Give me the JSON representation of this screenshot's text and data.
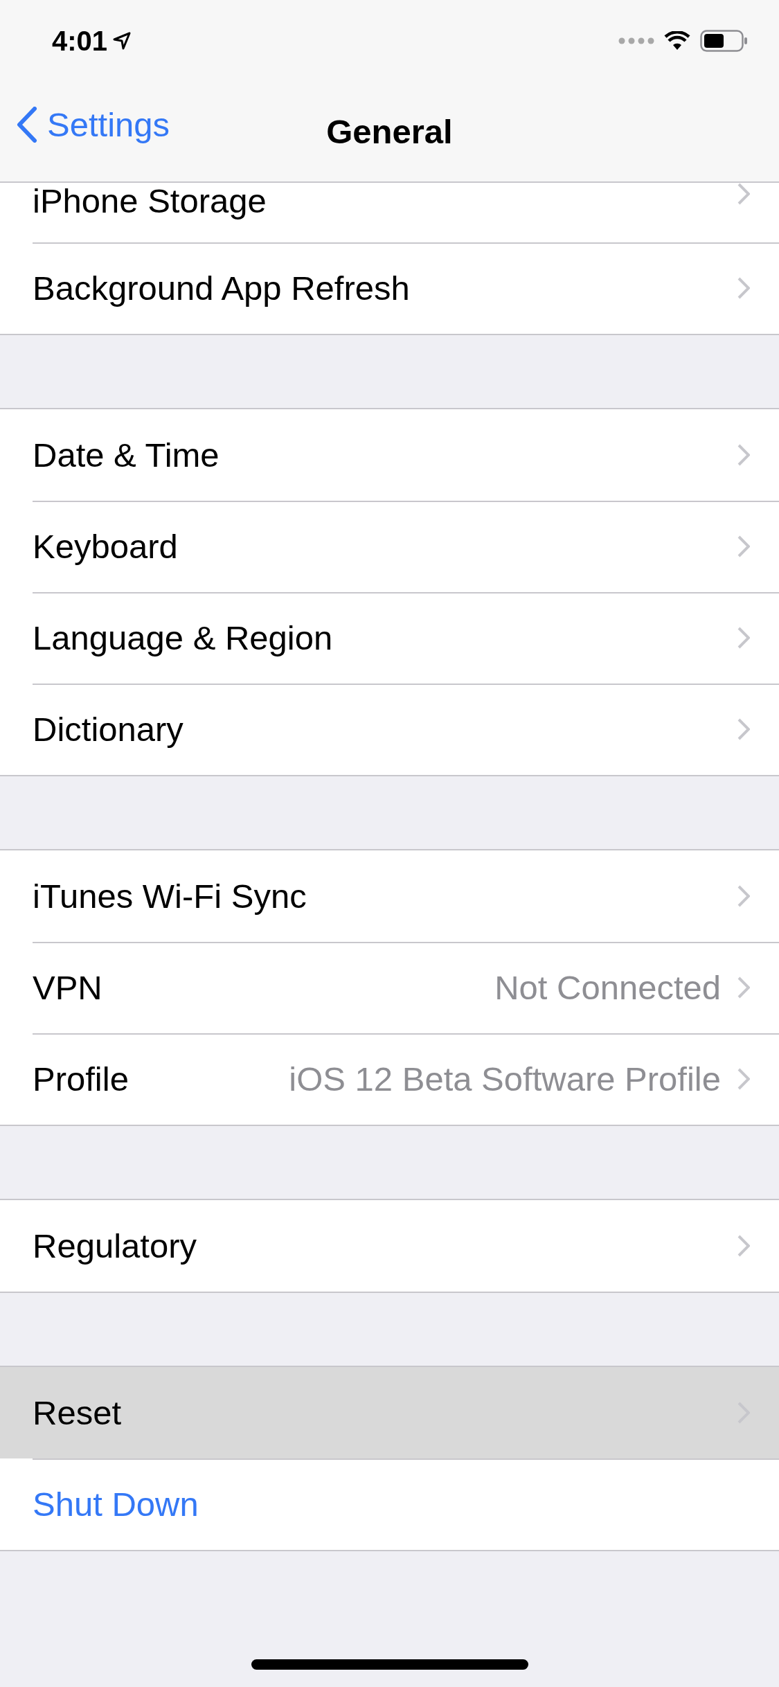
{
  "status_bar": {
    "time": "4:01"
  },
  "nav": {
    "back": "Settings",
    "title": "General"
  },
  "sections": [
    {
      "rows": [
        {
          "label": "iPhone Storage",
          "kind": "link",
          "selected": false
        },
        {
          "label": "Background App Refresh",
          "kind": "link",
          "selected": false
        }
      ]
    },
    {
      "rows": [
        {
          "label": "Date & Time",
          "kind": "link",
          "selected": false
        },
        {
          "label": "Keyboard",
          "kind": "link",
          "selected": false
        },
        {
          "label": "Language & Region",
          "kind": "link",
          "selected": false
        },
        {
          "label": "Dictionary",
          "kind": "link",
          "selected": false
        }
      ]
    },
    {
      "rows": [
        {
          "label": "iTunes Wi-Fi Sync",
          "kind": "link",
          "selected": false
        },
        {
          "label": "VPN",
          "value": "Not Connected",
          "kind": "link",
          "selected": false
        },
        {
          "label": "Profile",
          "value": "iOS 12 Beta Software Profile",
          "kind": "link",
          "selected": false
        }
      ]
    },
    {
      "rows": [
        {
          "label": "Regulatory",
          "kind": "link",
          "selected": false
        }
      ]
    },
    {
      "rows": [
        {
          "label": "Reset",
          "kind": "link",
          "selected": true
        },
        {
          "label": "Shut Down",
          "kind": "action",
          "selected": false
        }
      ]
    }
  ]
}
